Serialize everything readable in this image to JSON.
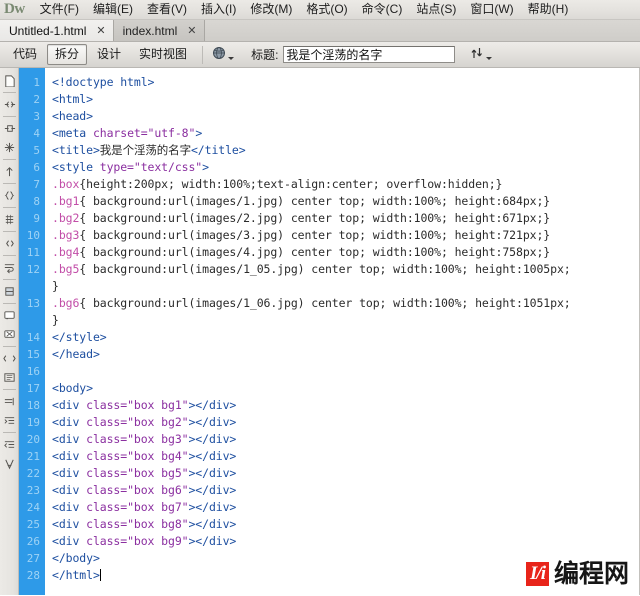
{
  "app": {
    "logo": "Dw",
    "watermark_badge": "I/i",
    "watermark_text": "编程网"
  },
  "menubar": {
    "items": [
      {
        "label": "文件(F)",
        "name": "menu-file"
      },
      {
        "label": "编辑(E)",
        "name": "menu-edit"
      },
      {
        "label": "查看(V)",
        "name": "menu-view"
      },
      {
        "label": "插入(I)",
        "name": "menu-insert"
      },
      {
        "label": "修改(M)",
        "name": "menu-modify"
      },
      {
        "label": "格式(O)",
        "name": "menu-format"
      },
      {
        "label": "命令(C)",
        "name": "menu-commands"
      },
      {
        "label": "站点(S)",
        "name": "menu-site"
      },
      {
        "label": "窗口(W)",
        "name": "menu-window"
      },
      {
        "label": "帮助(H)",
        "name": "menu-help"
      }
    ]
  },
  "tabs": {
    "close_glyph": "✕",
    "items": [
      {
        "label": "Untitled-1.html",
        "active": true
      },
      {
        "label": "index.html",
        "active": false
      }
    ]
  },
  "toolbar": {
    "view_buttons": [
      {
        "label": "代码",
        "pressed": false
      },
      {
        "label": "拆分",
        "pressed": true
      },
      {
        "label": "设计",
        "pressed": false
      },
      {
        "label": "实时视图",
        "pressed": false
      }
    ],
    "title_label": "标题:",
    "title_value": "我是个淫荡的名字",
    "title_placeholder": "无标题文档"
  },
  "rail": {
    "icons": [
      "open-documents-icon",
      "collapse-full-tag-icon",
      "collapse-selection-icon",
      "expand-all-icon",
      "select-parent-tag-icon",
      "balance-braces-icon",
      "line-numbers-icon",
      "highlight-invalid-code-icon",
      "word-wrap-icon",
      "syntax-color-icon",
      "apply-comment-icon",
      "remove-comment-icon",
      "wrap-tag-icon",
      "recent-snippets-icon",
      "move-or-convert-css-icon",
      "indent-code-icon",
      "outdent-code-icon",
      "format-source-code-icon"
    ]
  },
  "editor": {
    "gutter_numbers": [
      "1",
      "2",
      "3",
      "4",
      "5",
      "6",
      "7",
      "8",
      "9",
      "10",
      "11",
      "12",
      "",
      "13",
      "",
      "14",
      "15",
      "16",
      "17",
      "18",
      "19",
      "20",
      "21",
      "22",
      "23",
      "24",
      "25",
      "26",
      "27",
      "28"
    ],
    "lines": [
      {
        "n": "1",
        "segs": [
          {
            "t": "tag",
            "s": "<!doctype html>"
          }
        ]
      },
      {
        "n": "2",
        "segs": [
          {
            "t": "tag",
            "s": "<html>"
          }
        ]
      },
      {
        "n": "3",
        "segs": [
          {
            "t": "tag",
            "s": "<head>"
          }
        ]
      },
      {
        "n": "4",
        "segs": [
          {
            "t": "tag",
            "s": "<meta "
          },
          {
            "t": "attr",
            "s": "charset=\"utf-8\""
          },
          {
            "t": "tag",
            "s": ">"
          }
        ]
      },
      {
        "n": "5",
        "segs": [
          {
            "t": "tag",
            "s": "<title>"
          },
          {
            "t": "cjk",
            "s": "我是个淫荡的名字"
          },
          {
            "t": "tag",
            "s": "</title>"
          }
        ]
      },
      {
        "n": "6",
        "segs": [
          {
            "t": "tag",
            "s": "<style "
          },
          {
            "t": "attr",
            "s": "type=\"text/css\""
          },
          {
            "t": "tag",
            "s": ">"
          }
        ]
      },
      {
        "n": "7",
        "segs": [
          {
            "t": "sel",
            "s": ".box"
          },
          {
            "t": "plain",
            "s": "{height:200px; width:100%;text-align:center; overflow:hidden;}"
          }
        ]
      },
      {
        "n": "8",
        "segs": [
          {
            "t": "sel",
            "s": ".bg1"
          },
          {
            "t": "plain",
            "s": "{ background:url(images/1.jpg) center top; width:100%; height:684px;}"
          }
        ]
      },
      {
        "n": "9",
        "segs": [
          {
            "t": "sel",
            "s": ".bg2"
          },
          {
            "t": "plain",
            "s": "{ background:url(images/2.jpg) center top; width:100%; height:671px;}"
          }
        ]
      },
      {
        "n": "10",
        "segs": [
          {
            "t": "sel",
            "s": ".bg3"
          },
          {
            "t": "plain",
            "s": "{ background:url(images/3.jpg) center top; width:100%; height:721px;}"
          }
        ]
      },
      {
        "n": "11",
        "segs": [
          {
            "t": "sel",
            "s": ".bg4"
          },
          {
            "t": "plain",
            "s": "{ background:url(images/4.jpg) center top; width:100%; height:758px;}"
          }
        ]
      },
      {
        "n": "12",
        "segs": [
          {
            "t": "sel",
            "s": ".bg5"
          },
          {
            "t": "plain",
            "s": "{ background:url(images/1_05.jpg) center top; width:100%; height:1005px;"
          }
        ]
      },
      {
        "n": "",
        "segs": [
          {
            "t": "plain",
            "s": "}"
          }
        ]
      },
      {
        "n": "13",
        "segs": [
          {
            "t": "sel",
            "s": ".bg6"
          },
          {
            "t": "plain",
            "s": "{ background:url(images/1_06.jpg) center top; width:100%; height:1051px;"
          }
        ]
      },
      {
        "n": "",
        "segs": [
          {
            "t": "plain",
            "s": "}"
          }
        ]
      },
      {
        "n": "14",
        "segs": [
          {
            "t": "tag",
            "s": "</style>"
          }
        ]
      },
      {
        "n": "15",
        "segs": [
          {
            "t": "tag",
            "s": "</head>"
          }
        ]
      },
      {
        "n": "16",
        "segs": [
          {
            "t": "plain",
            "s": ""
          }
        ]
      },
      {
        "n": "17",
        "segs": [
          {
            "t": "tag",
            "s": "<body>"
          }
        ]
      },
      {
        "n": "18",
        "segs": [
          {
            "t": "tag",
            "s": "<div "
          },
          {
            "t": "attr",
            "s": "class=\"box bg1\""
          },
          {
            "t": "tag",
            "s": "></div>"
          }
        ]
      },
      {
        "n": "19",
        "segs": [
          {
            "t": "tag",
            "s": "<div "
          },
          {
            "t": "attr",
            "s": "class=\"box bg2\""
          },
          {
            "t": "tag",
            "s": "></div>"
          }
        ]
      },
      {
        "n": "20",
        "segs": [
          {
            "t": "tag",
            "s": "<div "
          },
          {
            "t": "attr",
            "s": "class=\"box bg3\""
          },
          {
            "t": "tag",
            "s": "></div>"
          }
        ]
      },
      {
        "n": "21",
        "segs": [
          {
            "t": "tag",
            "s": "<div "
          },
          {
            "t": "attr",
            "s": "class=\"box bg4\""
          },
          {
            "t": "tag",
            "s": "></div>"
          }
        ]
      },
      {
        "n": "22",
        "segs": [
          {
            "t": "tag",
            "s": "<div "
          },
          {
            "t": "attr",
            "s": "class=\"box bg5\""
          },
          {
            "t": "tag",
            "s": "></div>"
          }
        ]
      },
      {
        "n": "23",
        "segs": [
          {
            "t": "tag",
            "s": "<div "
          },
          {
            "t": "attr",
            "s": "class=\"box bg6\""
          },
          {
            "t": "tag",
            "s": "></div>"
          }
        ]
      },
      {
        "n": "24",
        "segs": [
          {
            "t": "tag",
            "s": "<div "
          },
          {
            "t": "attr",
            "s": "class=\"box bg7\""
          },
          {
            "t": "tag",
            "s": "></div>"
          }
        ]
      },
      {
        "n": "25",
        "segs": [
          {
            "t": "tag",
            "s": "<div "
          },
          {
            "t": "attr",
            "s": "class=\"box bg8\""
          },
          {
            "t": "tag",
            "s": "></div>"
          }
        ]
      },
      {
        "n": "26",
        "segs": [
          {
            "t": "tag",
            "s": "<div "
          },
          {
            "t": "attr",
            "s": "class=\"box bg9\""
          },
          {
            "t": "tag",
            "s": "></div>"
          }
        ]
      },
      {
        "n": "27",
        "segs": [
          {
            "t": "tag",
            "s": "</body>"
          }
        ]
      },
      {
        "n": "28",
        "segs": [
          {
            "t": "tag",
            "s": "</html>"
          },
          {
            "t": "caret",
            "s": ""
          }
        ]
      }
    ]
  },
  "colors": {
    "gutter_bg": "#2e9ae8",
    "gutter_fg": "#9ed3f5",
    "tag": "#1e4fa0",
    "attr": "#8b2fa0",
    "selector": "#c24ea8",
    "watermark_red": "#e8241a"
  }
}
